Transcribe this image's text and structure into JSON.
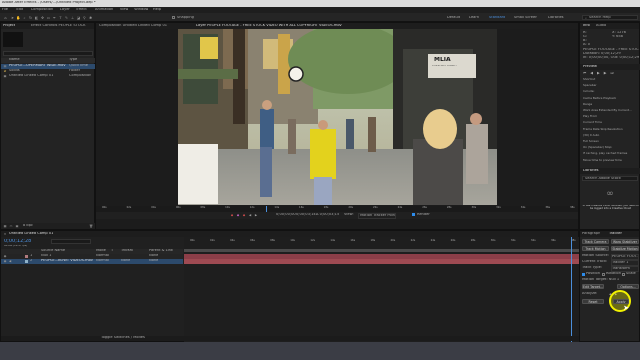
{
  "app": {
    "title": "Adobe After Effects - /Users/.../Untitled Project.aep *"
  },
  "menu": [
    "File",
    "Edit",
    "Composition",
    "Layer",
    "Effect",
    "Animation",
    "View",
    "Window",
    "Help"
  ],
  "toolbar": {
    "snapping_label": "Snapping",
    "workspaces": [
      "Default",
      "Learn",
      "Standard",
      "Small Screen",
      "Libraries"
    ],
    "search_placeholder": "Search Help"
  },
  "project_panel": {
    "tab_label": "Project",
    "controls_tab": "Effect Controls PEOPLE STOCK",
    "columns": [
      "Name",
      "Type"
    ],
    "items": [
      {
        "name": "PEOPLE...UPERMART WIDE.mov",
        "type": "QuickTime"
      },
      {
        "name": "Solids",
        "type": "Folder"
      },
      {
        "name": "Untitled Linked Comp 01",
        "type": "Composition"
      }
    ],
    "footer": "8 bpc"
  },
  "comp_viewer": {
    "tab_label": "Composition Untitled Linked Comp 01",
    "layer_tab": "Layer PEOPLE FOOTAGE - FREE STOCK VIDEO WITH ALL COPYRIGHT VIDEOS.mov",
    "sign_text": "MLIA",
    "sign_sub": "CHESTNUT STREET",
    "view_label": "View:",
    "view_value": "Motion Tracker Points",
    "render_label": "Render",
    "ruler": [
      "00s",
      "02s",
      "04s",
      "06s",
      "08s",
      "10s",
      "12s",
      "14s",
      "16s",
      "18s",
      "20s",
      "22s",
      "24s",
      "26s",
      "28s",
      "30s",
      "32s",
      "34s",
      "36s",
      "38s"
    ],
    "timecodes": [
      "0;00;00;00",
      "0;00;03;14",
      "Δ 0;00;03;15"
    ]
  },
  "right_panel": {
    "info_tab": "Info",
    "audio_tab": "Audio",
    "info": [
      "R:",
      "G:",
      "B:",
      "A: 0",
      "X: 1276",
      "Y: 658"
    ],
    "file_info": [
      "PEOPLE FOOTAGE - FREE STOCK",
      "Duration: 0;00;12;29",
      "In: 0;00;00;00, Out: 0;00;12;29"
    ],
    "preview_tab": "Preview",
    "preview_rows": [
      "Shortcut",
      "Spacebar",
      "Include: ",
      "Cache Before Playback",
      "Range",
      "Work Area Extended By Current...",
      "Play From",
      "Current Time",
      "Frame Rate   Skip   Resolution",
      "(30)     0       Auto",
      "Full Screen",
      "On (Spacebar) Stop:",
      "If caching, play cached frames",
      "Move time to preview time"
    ],
    "libraries_tab": "Libraries",
    "libraries_search": "Search Adobe Stock",
    "libraries_msg": "To use Creative Cloud libraries, you need to be logged into a Creative Cloud"
  },
  "tracker": {
    "tabs": [
      "Paragraph",
      "Tracker"
    ],
    "buttons": [
      "Track Camera",
      "Warp Stabilizer",
      "Track Motion",
      "Stabilize Motion"
    ],
    "rows": [
      {
        "label": "Motion Source:",
        "value": "PEOPLE FOOT..."
      },
      {
        "label": "Current Track:",
        "value": "Tracker 1"
      },
      {
        "label": "Track Type:",
        "value": "Transform"
      }
    ],
    "checks": [
      "Position",
      "Rotation",
      "Scale"
    ],
    "motion_target": "Motion Target: Null 1",
    "edit_target": "Edit Target...",
    "options": "Options...",
    "analyze": "Analyze:",
    "reset": "Reset",
    "apply": "Apply"
  },
  "timeline": {
    "tab_label": "Untitled Linked Comp 01",
    "timecode": "0;00;12;28",
    "fps": "00388 (29.97 fps)",
    "columns": [
      "Source Name",
      "Mode",
      "T",
      "TrkMat",
      "Parent & Link"
    ],
    "layers": [
      {
        "num": "1",
        "name": "Null 1",
        "mode": "Normal",
        "trkmat": "",
        "parent": "None"
      },
      {
        "num": "2",
        "name": "PEOPLE...BOWT VIDEOS.mov",
        "mode": "Normal",
        "trkmat": "None",
        "parent": "None"
      }
    ],
    "ruler": [
      "00s",
      "02s",
      "04s",
      "06s",
      "08s",
      "10s",
      "12s",
      "14s",
      "16s",
      "18s",
      "20s",
      "22s",
      "24s",
      "26s",
      "28s",
      "30s",
      "32s",
      "34s",
      "36s",
      "38s"
    ],
    "footer": "Toggle Switches / Modes"
  },
  "colors": {
    "accent": "#2d8ceb",
    "playhead": "#4b8fdc",
    "layer1": "#8c3e48",
    "layer2": "#9e4a52",
    "cursor_highlight": "#f2f200"
  }
}
